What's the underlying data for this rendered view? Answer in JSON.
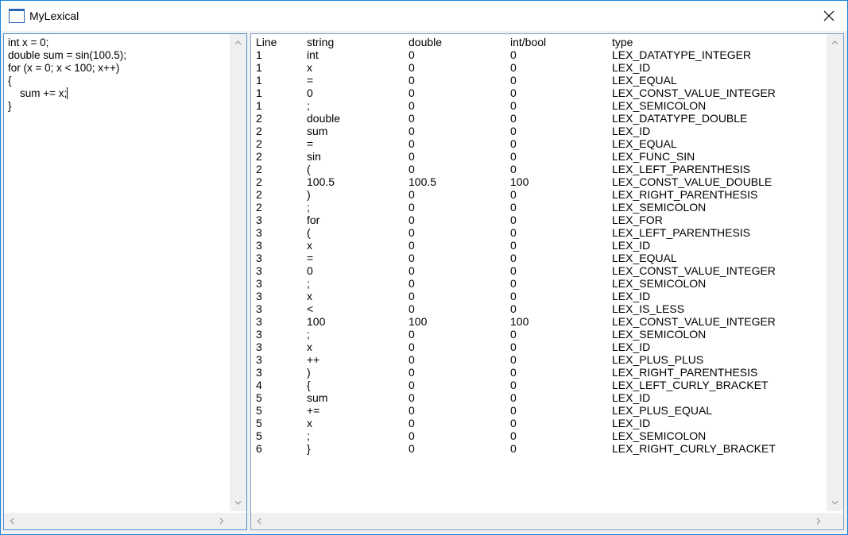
{
  "window": {
    "title": "MyLexical"
  },
  "editor": {
    "lines": [
      "int x = 0;",
      "double sum = sin(100.5);",
      "for (x = 0; x < 100; x++)",
      "{",
      "    sum += x;",
      "}"
    ]
  },
  "table": {
    "headers": {
      "line": "Line",
      "string": "string",
      "double": "double",
      "intbool": "int/bool",
      "type": "type"
    },
    "rows": [
      [
        "1",
        "int",
        "0",
        "0",
        "LEX_DATATYPE_INTEGER"
      ],
      [
        "1",
        "x",
        "0",
        "0",
        "LEX_ID"
      ],
      [
        "1",
        "=",
        "0",
        "0",
        "LEX_EQUAL"
      ],
      [
        "1",
        "0",
        "0",
        "0",
        "LEX_CONST_VALUE_INTEGER"
      ],
      [
        "1",
        ";",
        "0",
        "0",
        "LEX_SEMICOLON"
      ],
      [
        "2",
        "double",
        "0",
        "0",
        "LEX_DATATYPE_DOUBLE"
      ],
      [
        "2",
        "sum",
        "0",
        "0",
        "LEX_ID"
      ],
      [
        "2",
        "=",
        "0",
        "0",
        "LEX_EQUAL"
      ],
      [
        "2",
        "sin",
        "0",
        "0",
        "LEX_FUNC_SIN"
      ],
      [
        "2",
        "(",
        "0",
        "0",
        "LEX_LEFT_PARENTHESIS"
      ],
      [
        "2",
        "100.5",
        "100.5",
        "100",
        "LEX_CONST_VALUE_DOUBLE"
      ],
      [
        "2",
        ")",
        "0",
        "0",
        "LEX_RIGHT_PARENTHESIS"
      ],
      [
        "2",
        ";",
        "0",
        "0",
        "LEX_SEMICOLON"
      ],
      [
        "3",
        "for",
        "0",
        "0",
        "LEX_FOR"
      ],
      [
        "3",
        "(",
        "0",
        "0",
        "LEX_LEFT_PARENTHESIS"
      ],
      [
        "3",
        "x",
        "0",
        "0",
        "LEX_ID"
      ],
      [
        "3",
        "=",
        "0",
        "0",
        "LEX_EQUAL"
      ],
      [
        "3",
        "0",
        "0",
        "0",
        "LEX_CONST_VALUE_INTEGER"
      ],
      [
        "3",
        ";",
        "0",
        "0",
        "LEX_SEMICOLON"
      ],
      [
        "3",
        "x",
        "0",
        "0",
        "LEX_ID"
      ],
      [
        "3",
        "<",
        "0",
        "0",
        "LEX_IS_LESS"
      ],
      [
        "3",
        "100",
        "100",
        "100",
        "LEX_CONST_VALUE_INTEGER"
      ],
      [
        "3",
        ";",
        "0",
        "0",
        "LEX_SEMICOLON"
      ],
      [
        "3",
        "x",
        "0",
        "0",
        "LEX_ID"
      ],
      [
        "3",
        "++",
        "0",
        "0",
        "LEX_PLUS_PLUS"
      ],
      [
        "3",
        ")",
        "0",
        "0",
        "LEX_RIGHT_PARENTHESIS"
      ],
      [
        "4",
        "{",
        "0",
        "0",
        "LEX_LEFT_CURLY_BRACKET"
      ],
      [
        "5",
        "sum",
        "0",
        "0",
        "LEX_ID"
      ],
      [
        "5",
        "+=",
        "0",
        "0",
        "LEX_PLUS_EQUAL"
      ],
      [
        "5",
        "x",
        "0",
        "0",
        "LEX_ID"
      ],
      [
        "5",
        ";",
        "0",
        "0",
        "LEX_SEMICOLON"
      ],
      [
        "6",
        "}",
        "0",
        "0",
        "LEX_RIGHT_CURLY_BRACKET"
      ]
    ]
  },
  "colors": {
    "accent_border": "#1883d7",
    "scrollbar_bg": "#f0f0f0",
    "arrow": "#a0a0a0"
  },
  "icons": {
    "app": "window-icon",
    "close": "close-icon",
    "up": "arrow-up-icon",
    "down": "arrow-down-icon",
    "left": "arrow-left-icon",
    "right": "arrow-right-icon"
  }
}
